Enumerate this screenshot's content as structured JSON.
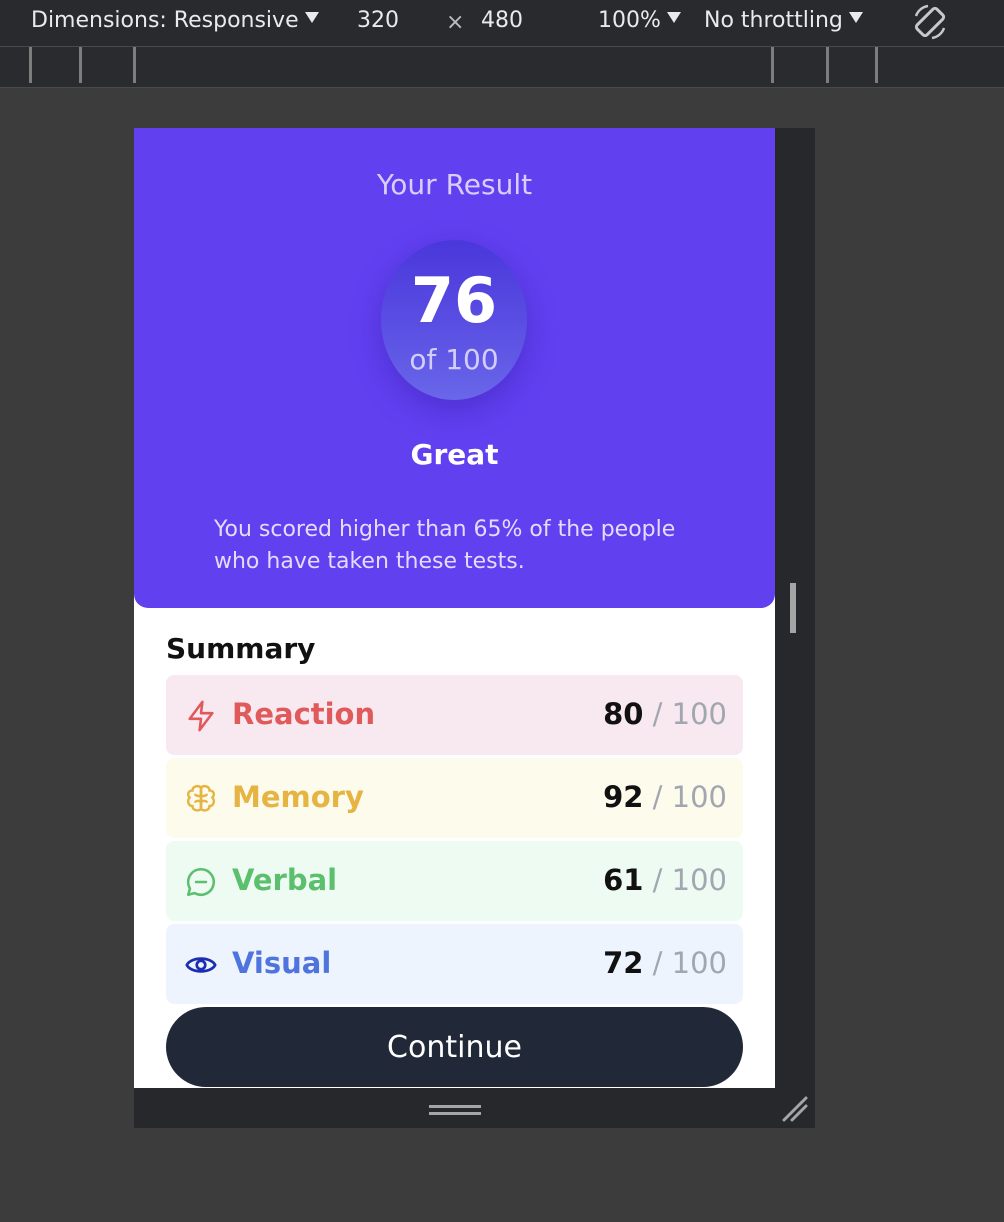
{
  "devtools": {
    "dimensions_label": "Dimensions: Responsive",
    "width": "320",
    "times": "×",
    "height": "480",
    "zoom": "100%",
    "throttling": "No throttling",
    "rotate_icon": "rotate-icon"
  },
  "result": {
    "title": "Your Result",
    "score": "76",
    "out_of": "of 100",
    "rating": "Great",
    "description": "You scored higher than 65% of the people who have taken these tests.",
    "background": "#6140f0"
  },
  "summary": {
    "title": "Summary",
    "items": [
      {
        "label": "Reaction",
        "score": "80",
        "max": "/ 100",
        "icon": "lightning-icon",
        "color": "#e0595b",
        "bg": "#f8e8ef"
      },
      {
        "label": "Memory",
        "score": "92",
        "max": "/ 100",
        "icon": "brain-icon",
        "color": "#e5b443",
        "bg": "#fdfbeb"
      },
      {
        "label": "Verbal",
        "score": "61",
        "max": "/ 100",
        "icon": "chat-bubble-icon",
        "color": "#5bbf6e",
        "bg": "#eefbf3"
      },
      {
        "label": "Visual",
        "score": "72",
        "max": "/ 100",
        "icon": "eye-icon",
        "color": "#4f74de",
        "bg": "#eef4fd"
      }
    ],
    "continue_label": "Continue"
  }
}
